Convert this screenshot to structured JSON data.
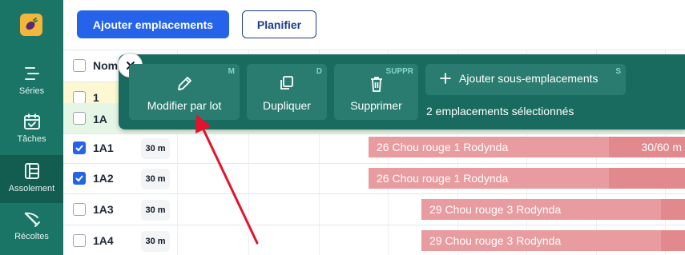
{
  "sidebar": {
    "logo_icon": "eggplant-logo-icon",
    "items": [
      {
        "label": "Séries",
        "icon": "series-icon"
      },
      {
        "label": "Tâches",
        "icon": "calendar-check-icon"
      },
      {
        "label": "Assolement",
        "icon": "layout-icon",
        "active": true
      },
      {
        "label": "Récoltes",
        "icon": "harvest-icon"
      }
    ]
  },
  "toolbar": {
    "add_label": "Ajouter emplacements",
    "plan_label": "Planifier"
  },
  "table": {
    "header": {
      "name": "Nom"
    },
    "rows": [
      {
        "name": "1",
        "checked": false
      },
      {
        "name": "1A",
        "checked": false
      },
      {
        "name": "1A1",
        "length": "30 m",
        "checked": true
      },
      {
        "name": "1A2",
        "length": "30 m",
        "checked": true
      },
      {
        "name": "1A3",
        "length": "30 m",
        "checked": false
      },
      {
        "name": "1A4",
        "length": "30 m",
        "checked": false
      }
    ]
  },
  "bars": [
    {
      "label": "26 Chou rouge 1 Rodynda",
      "end_label": "30/60 m"
    },
    {
      "label": "26 Chou rouge 1 Rodynda",
      "end_label": ""
    },
    {
      "label": "29 Chou rouge 3 Rodynda",
      "end_label": ""
    },
    {
      "label": "29 Chou rouge 3 Rodynda",
      "end_label": ""
    }
  ],
  "action_panel": {
    "close_icon": "close-icon",
    "actions": {
      "modifier": {
        "label": "Modifier par lot",
        "shortcut": "M",
        "icon": "pencil-icon"
      },
      "dupliquer": {
        "label": "Dupliquer",
        "shortcut": "D",
        "icon": "copy-icon"
      },
      "supprimer": {
        "label": "Supprimer",
        "shortcut": "SUPPR",
        "icon": "trash-icon"
      },
      "ajouter": {
        "label": "Ajouter sous-emplacements",
        "shortcut": "S",
        "icon": "plus-icon"
      }
    },
    "selection_text": "2 emplacements sélectionnés"
  },
  "colors": {
    "sidebar": "#1a7566",
    "panel": "#1a6b5f",
    "primary": "#2563eb",
    "bar": "#e89c9f",
    "annotation_arrow": "#e3122c"
  }
}
